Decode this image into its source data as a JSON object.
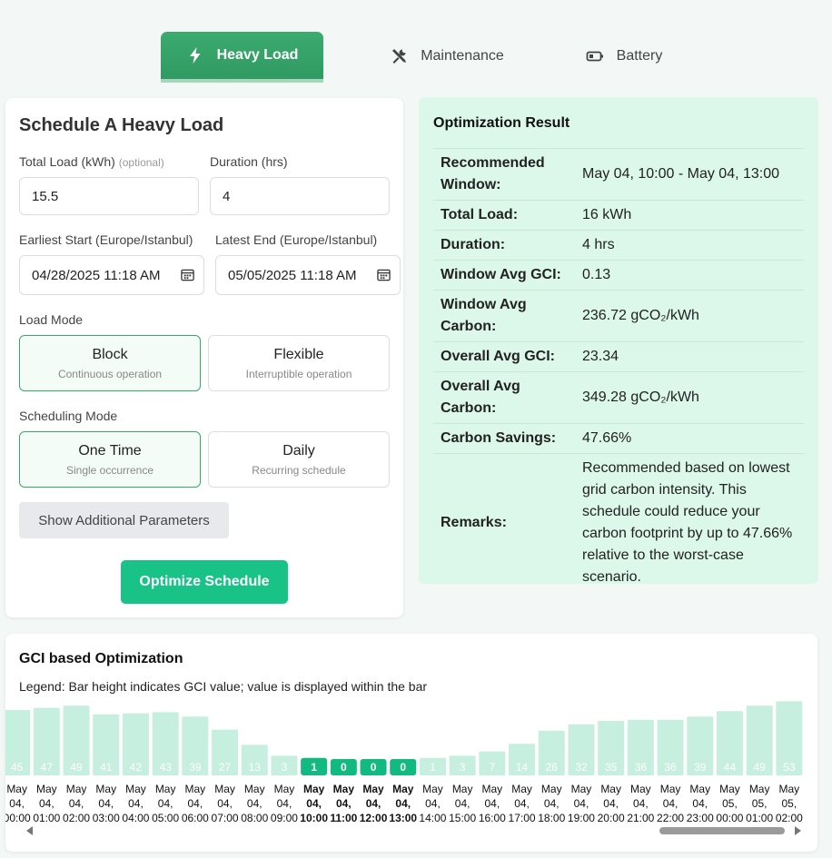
{
  "tabs": [
    {
      "label": "Heavy Load",
      "icon": "lightning-icon"
    },
    {
      "label": "Maintenance",
      "icon": "tools-icon"
    },
    {
      "label": "Battery",
      "icon": "battery-icon"
    }
  ],
  "form": {
    "title": "Schedule A Heavy Load",
    "total_load_label": "Total Load (kWh)",
    "total_load_optional": "(optional)",
    "total_load_value": "15.5",
    "duration_label": "Duration (hrs)",
    "duration_value": "4",
    "earliest_label": "Earliest Start (Europe/Istanbul)",
    "earliest_value": "04/28/2025 11:18 AM",
    "latest_label": "Latest End (Europe/Istanbul)",
    "latest_value": "05/05/2025 11:18 AM",
    "load_mode_label": "Load Mode",
    "load_modes": [
      {
        "title": "Block",
        "sub": "Continuous operation",
        "selected": true
      },
      {
        "title": "Flexible",
        "sub": "Interruptible operation",
        "selected": false
      }
    ],
    "scheduling_mode_label": "Scheduling Mode",
    "scheduling_modes": [
      {
        "title": "One Time",
        "sub": "Single occurrence",
        "selected": true
      },
      {
        "title": "Daily",
        "sub": "Recurring schedule",
        "selected": false
      }
    ],
    "additional_button": "Show Additional Parameters",
    "optimize_button": "Optimize Schedule"
  },
  "result": {
    "title": "Optimization Result",
    "rows": [
      {
        "key": "Recommended Window:",
        "value": "May 04, 10:00 - May 04, 13:00"
      },
      {
        "key": "Total Load:",
        "value": "16 kWh"
      },
      {
        "key": "Duration:",
        "value": "4 hrs"
      },
      {
        "key": "Window Avg GCI:",
        "value": "0.13"
      },
      {
        "key": "Window Avg Carbon:",
        "value": "236.72 gCO₂/kWh"
      },
      {
        "key": "Overall Avg GCI:",
        "value": "23.34"
      },
      {
        "key": "Overall Avg Carbon:",
        "value": "349.28 gCO₂/kWh"
      },
      {
        "key": "Carbon Savings:",
        "value": "47.66%"
      },
      {
        "key": "Remarks:",
        "value": "Recommended based on lowest grid carbon intensity. This schedule could reduce your carbon footprint by up to 47.66% relative to the worst-case scenario."
      }
    ]
  },
  "chart": {
    "title": "GCI based Optimization",
    "legend": "Legend: Bar height indicates GCI value; value is displayed within the bar"
  },
  "chart_data": {
    "type": "bar",
    "categories": [
      "May 04, 00:00",
      "May 04, 01:00",
      "May 04, 02:00",
      "May 04, 03:00",
      "May 04, 04:00",
      "May 04, 05:00",
      "May 04, 06:00",
      "May 04, 07:00",
      "May 04, 08:00",
      "May 04, 09:00",
      "May 04, 10:00",
      "May 04, 11:00",
      "May 04, 12:00",
      "May 04, 13:00",
      "May 04, 14:00",
      "May 04, 15:00",
      "May 04, 16:00",
      "May 04, 17:00",
      "May 04, 18:00",
      "May 04, 19:00",
      "May 04, 20:00",
      "May 04, 21:00",
      "May 04, 22:00",
      "May 04, 23:00",
      "May 05, 00:00",
      "May 05, 01:00",
      "May 05, 02:00"
    ],
    "values": [
      45,
      47,
      49,
      41,
      42,
      43,
      39,
      27,
      13,
      3,
      1,
      0,
      0,
      0,
      1,
      3,
      7,
      14,
      26,
      32,
      35,
      36,
      36,
      39,
      44,
      49,
      53
    ],
    "highlighted": [
      false,
      false,
      false,
      false,
      false,
      false,
      false,
      false,
      false,
      false,
      true,
      true,
      true,
      true,
      false,
      false,
      false,
      false,
      false,
      false,
      false,
      false,
      false,
      false,
      false,
      false,
      false
    ],
    "colors": {
      "normal": "#c6efdf",
      "highlight": "#12b981"
    },
    "title": "GCI based Optimization",
    "xlabel": "",
    "ylabel": ""
  }
}
